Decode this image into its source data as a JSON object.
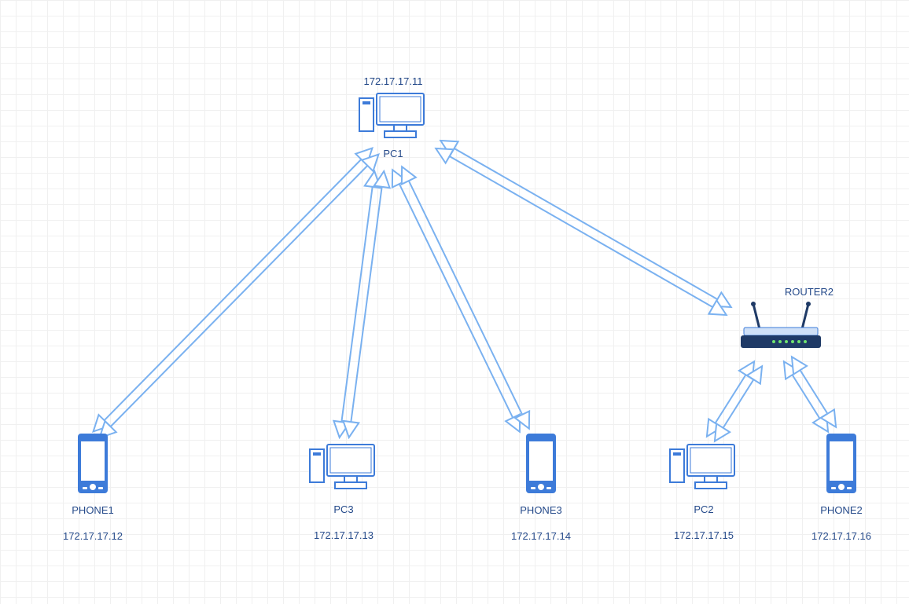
{
  "nodes": {
    "pc1": {
      "name": "PC1",
      "ip": "172.17.17.11"
    },
    "phone1": {
      "name": "PHONE1",
      "ip": "172.17.17.12"
    },
    "pc3": {
      "name": "PC3",
      "ip": "172.17.17.13"
    },
    "phone3": {
      "name": "PHONE3",
      "ip": "172.17.17.14"
    },
    "pc2": {
      "name": "PC2",
      "ip": "172.17.17.15"
    },
    "phone2": {
      "name": "PHONE2",
      "ip": "172.17.17.16"
    },
    "router2": {
      "name": "ROUTER2",
      "ip": ""
    }
  },
  "edges": [
    {
      "from": "pc1",
      "to": "phone1"
    },
    {
      "from": "pc1",
      "to": "pc3"
    },
    {
      "from": "pc1",
      "to": "phone3"
    },
    {
      "from": "pc1",
      "to": "router2"
    },
    {
      "from": "router2",
      "to": "pc2"
    },
    {
      "from": "router2",
      "to": "phone2"
    }
  ],
  "colors": {
    "stroke": "#7ab1f0",
    "text": "#254a8a",
    "fillBlue": "#3d7bd9",
    "fillWhite": "#ffffff"
  }
}
